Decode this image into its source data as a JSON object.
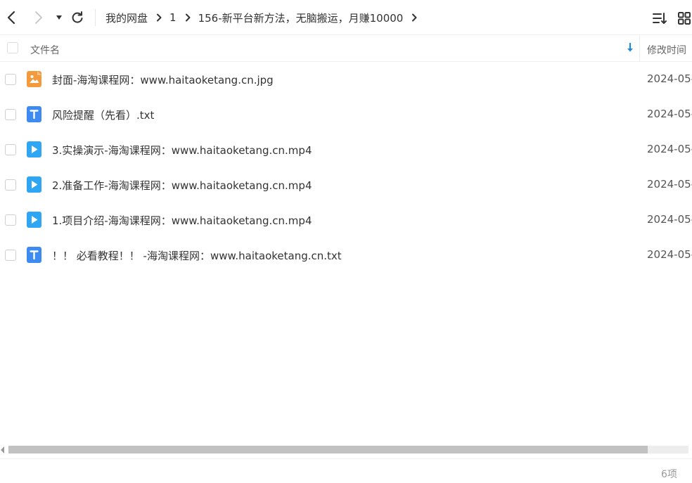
{
  "toolbar": {
    "back_icon": "chevron-left-icon",
    "forward_icon": "chevron-right-icon",
    "history_icon": "caret-down-icon",
    "refresh_icon": "refresh-icon",
    "sort_order_icon": "sort-list-icon",
    "view_grid_icon": "grid-view-icon"
  },
  "breadcrumb": [
    "我的网盘",
    "1",
    "156-新平台新方法，无脑搬运，月赚10000"
  ],
  "columns": {
    "name": "文件名",
    "modified": "修改时间",
    "sort_icon": "sort-desc-arrow-icon"
  },
  "files": [
    {
      "name": "封面-海淘课程网：www.haitaoketang.cn.jpg",
      "date": "2024-05-",
      "type": "image",
      "icon": "image-file-icon"
    },
    {
      "name": "风险提醒（先看）.txt",
      "date": "2024-05-",
      "type": "text",
      "icon": "text-file-icon"
    },
    {
      "name": "3.实操演示-海淘课程网：www.haitaoketang.cn.mp4",
      "date": "2024-05-",
      "type": "video",
      "icon": "video-file-icon"
    },
    {
      "name": "2.准备工作-海淘课程网：www.haitaoketang.cn.mp4",
      "date": "2024-05-",
      "type": "video",
      "icon": "video-file-icon"
    },
    {
      "name": "1.项目介绍-海淘课程网：www.haitaoketang.cn.mp4",
      "date": "2024-05-",
      "type": "video",
      "icon": "video-file-icon"
    },
    {
      "name": "！！ 必看教程！！ -海淘课程网：www.haitaoketang.cn.txt",
      "date": "2024-05-",
      "type": "text",
      "icon": "text-file-icon"
    }
  ],
  "status": {
    "count": "6项"
  },
  "colors": {
    "image_icon": "#f59a3c",
    "text_icon": "#3d8bf0",
    "video_icon": "#2fa6f3",
    "accent": "#1e88e5"
  }
}
